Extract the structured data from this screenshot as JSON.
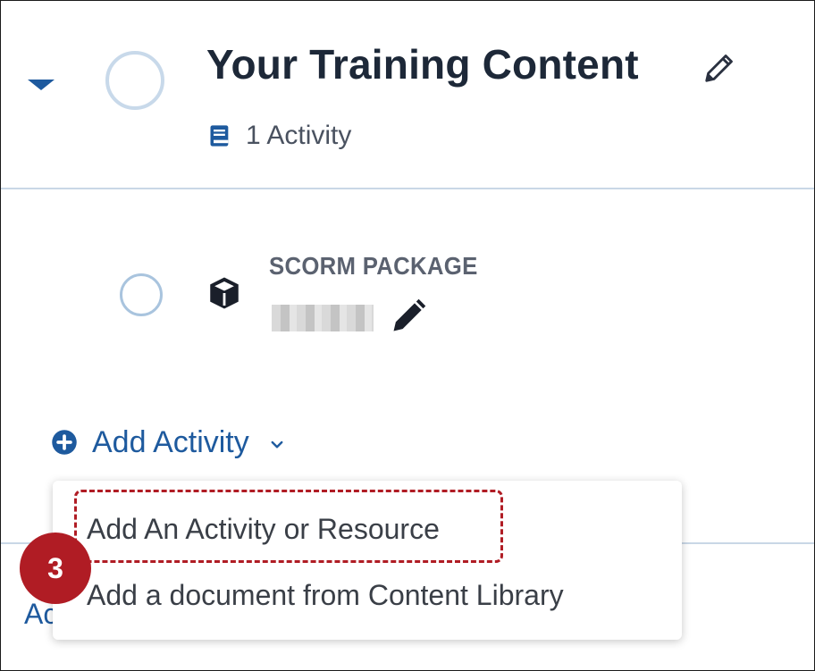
{
  "section": {
    "title": "Your Training Content",
    "activity_count": "1 Activity"
  },
  "item": {
    "type_label": "SCORM PACKAGE"
  },
  "add_activity": {
    "label": "Add Activity"
  },
  "dropdown": {
    "items": [
      {
        "label": "Add An Activity or Resource"
      },
      {
        "label": "Add a document from Content Library"
      }
    ]
  },
  "behind_text": "Ac",
  "step_badge": "3",
  "colors": {
    "accent": "#1e5a9e",
    "highlight": "#b01c24",
    "divider": "#c9d7e6"
  }
}
